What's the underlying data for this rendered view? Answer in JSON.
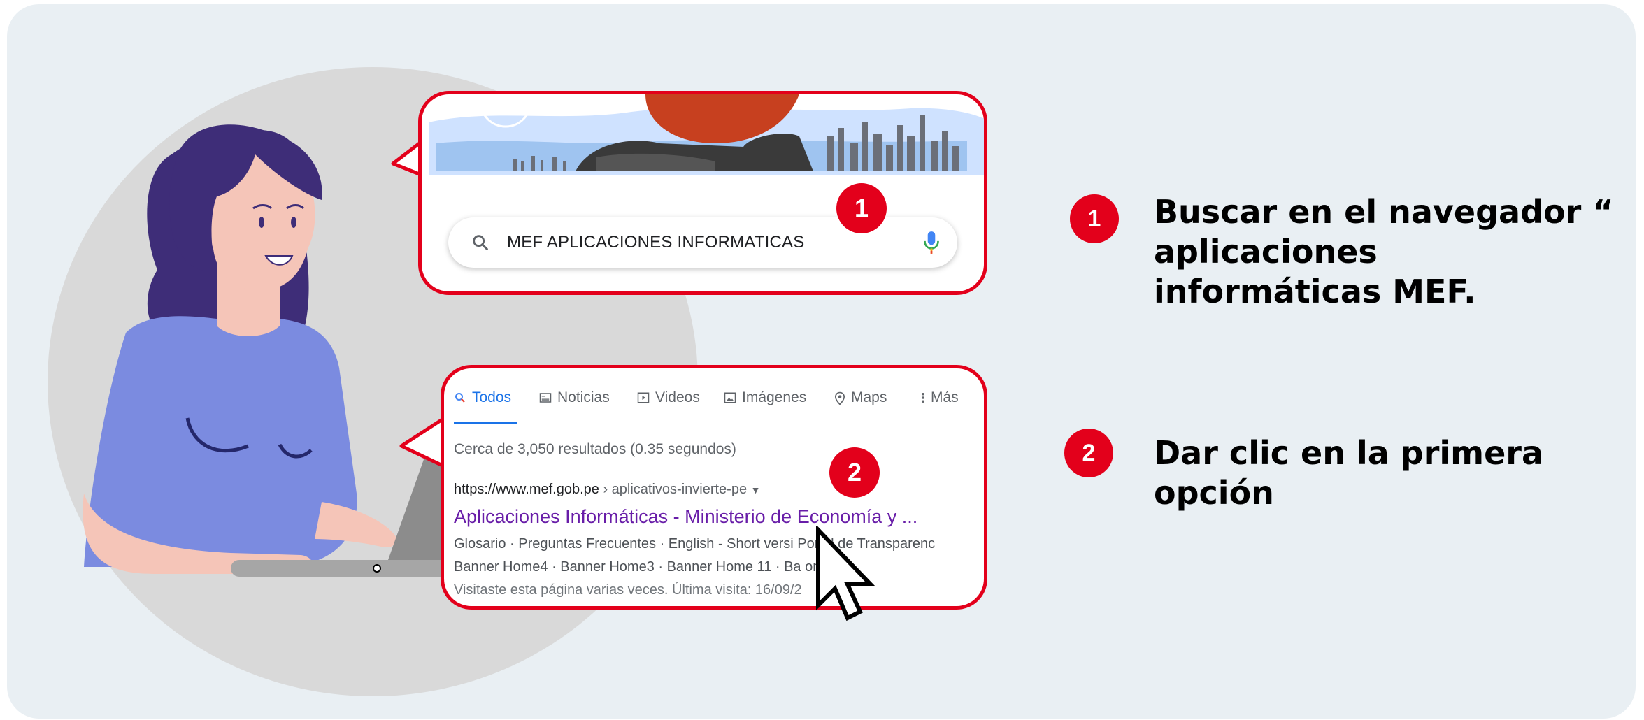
{
  "search": {
    "query": "MEF APLICACIONES INFORMATICAS"
  },
  "serp": {
    "tabs": [
      {
        "label": "Todos",
        "icon": "search-icon",
        "active": true
      },
      {
        "label": "Noticias",
        "icon": "newspaper-icon"
      },
      {
        "label": "Videos",
        "icon": "play-icon"
      },
      {
        "label": "Imágenes",
        "icon": "image-icon"
      },
      {
        "label": "Maps",
        "icon": "map-pin-icon"
      },
      {
        "label": "Más",
        "icon": "more-vert-icon"
      }
    ],
    "result_count": "Cerca de 3,050 resultados (0.35 segundos)",
    "result": {
      "url_host": "https://www.mef.gob.pe",
      "url_path": " › aplicativos-invierte-pe",
      "title": "Aplicaciones Informáticas - Ministerio de Economía y ...",
      "line1": "Glosario · Preguntas Frecuentes · English - Short versi     Portal de Transparenc",
      "line2": "Banner Home4 · Banner Home3 · Banner Home 11 · Ba         ome7 ...",
      "line3": "Visitaste esta página varias veces. Última visita: 16/09/2"
    }
  },
  "markers": {
    "bubble1": "1",
    "bubble2": "2"
  },
  "steps": [
    {
      "number": "1",
      "text": "Buscar en el navegador “ aplicaciones informáticas MEF."
    },
    {
      "number": "2",
      "text": "Dar clic en la primera opción"
    }
  ],
  "colors": {
    "accent_red": "#e3001b",
    "link_purple": "#681da8",
    "tab_blue": "#1a73e8",
    "panel_bg": "#e9eff3"
  }
}
